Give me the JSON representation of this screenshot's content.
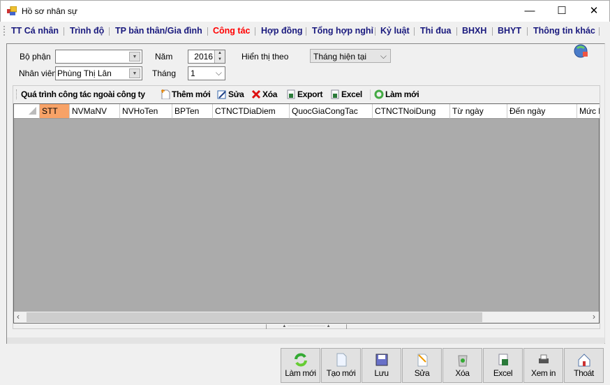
{
  "window": {
    "title": "Hồ sơ nhân sự",
    "minimize": "—",
    "maximize": "☐",
    "close": "✕"
  },
  "tabs": [
    {
      "label": "TT Cá nhân"
    },
    {
      "label": "Trình độ"
    },
    {
      "label": "TP bản thân/Gia đình"
    },
    {
      "label": "Công tác",
      "active": true
    },
    {
      "label": "Hợp đồng"
    },
    {
      "label": "Tổng hợp nghỉ"
    },
    {
      "label": "Kỷ luật"
    },
    {
      "label": "Thi đua"
    },
    {
      "label": "BHXH"
    },
    {
      "label": "BHYT"
    },
    {
      "label": "Thông tin khác"
    }
  ],
  "filters": {
    "bo_phan_label": "Bộ phận",
    "bo_phan_value": "",
    "nhan_vien_label": "Nhân viên",
    "nhan_vien_value": "Phùng Thị Lân",
    "nam_label": "Năm",
    "nam_value": "2016",
    "thang_label": "Tháng",
    "thang_value": "1",
    "hien_thi_label": "Hiển thị theo",
    "hien_thi_value": "Tháng hiện tại"
  },
  "toolbar": {
    "title": "Quá trình công tác ngoài công ty",
    "add": "Thêm mới",
    "edit": "Sửa",
    "delete": "Xóa",
    "export": "Export",
    "excel": "Excel",
    "refresh": "Làm mới"
  },
  "grid": {
    "columns": [
      "STT",
      "NVMaNV",
      "NVHoTen",
      "BPTen",
      "CTNCTDiaDiem",
      "QuocGiaCongTac",
      "CTNCTNoiDung",
      "Từ ngày",
      "Đến ngày",
      "Mức l"
    ],
    "rows": []
  },
  "bottom_buttons": [
    {
      "label": "Làm mới",
      "icon": "refresh-icon"
    },
    {
      "label": "Tạo mới",
      "icon": "new-document-icon"
    },
    {
      "label": "Lưu",
      "icon": "save-icon"
    },
    {
      "label": "Sửa",
      "icon": "edit-icon"
    },
    {
      "label": "Xóa",
      "icon": "recycle-bin-icon"
    },
    {
      "label": "Excel",
      "icon": "excel-icon"
    },
    {
      "label": "Xem in",
      "icon": "printer-icon"
    },
    {
      "label": "Thoát",
      "icon": "home-icon"
    }
  ],
  "colors": {
    "active_tab": "#ff0000",
    "tab_text": "#1a1a7e",
    "selected_header": "#f7a267",
    "grid_bg": "#ababab"
  }
}
